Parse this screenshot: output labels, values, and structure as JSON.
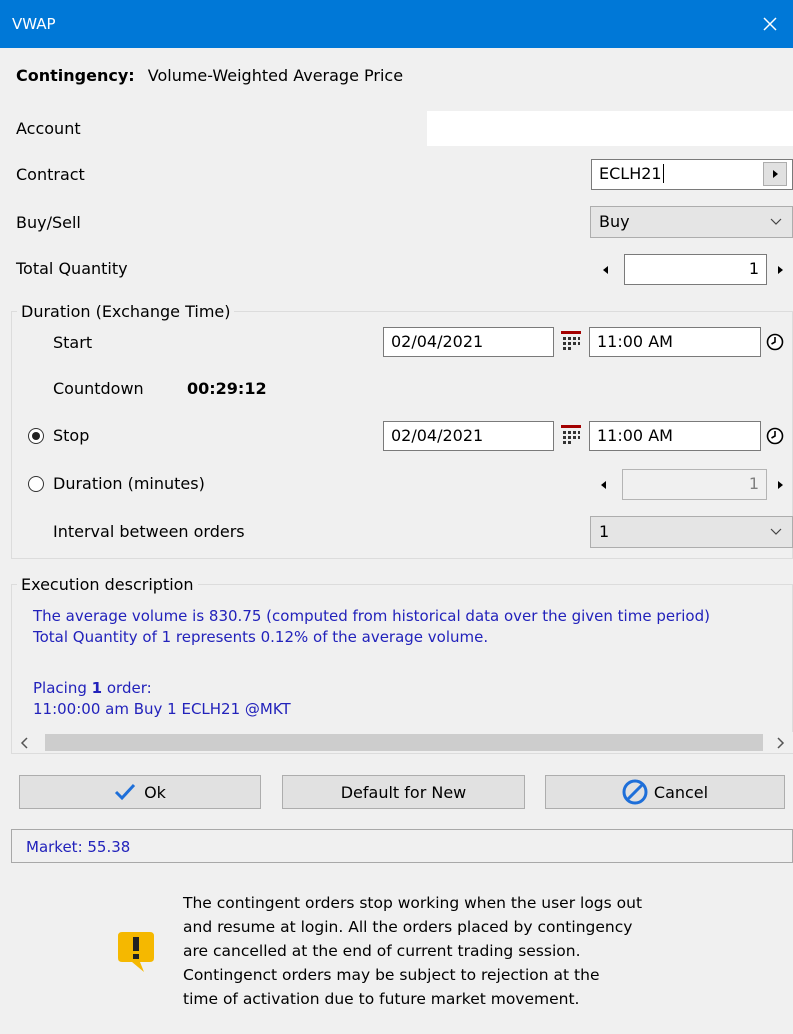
{
  "window": {
    "title": "VWAP"
  },
  "contingency": {
    "label": "Contingency:",
    "value": "Volume-Weighted Average Price"
  },
  "account": {
    "label": "Account",
    "value": ""
  },
  "contract": {
    "label": "Contract",
    "value": "ECLH21"
  },
  "buy_sell": {
    "label": "Buy/Sell",
    "value": "Buy"
  },
  "total_quantity": {
    "label": "Total Quantity",
    "value": "1"
  },
  "duration": {
    "group_title": "Duration (Exchange Time)",
    "start": {
      "label": "Start",
      "date": "02/04/2021",
      "time": "11:00 AM"
    },
    "countdown": {
      "label": "Countdown",
      "value": "00:29:12"
    },
    "stop": {
      "label": "Stop",
      "date": "02/04/2021",
      "time": "11:00 AM",
      "selected": true
    },
    "duration_minutes": {
      "label": "Duration (minutes)",
      "value": "1",
      "selected": false
    },
    "interval": {
      "label": "Interval between orders",
      "value": "1"
    }
  },
  "execution": {
    "group_title": "Execution description",
    "line1": "The average volume is 830.75 (computed from historical data over the given time period)",
    "line2": "Total Quantity of 1 represents 0.12% of the average volume.",
    "placing_prefix": "Placing",
    "placing_count": "1",
    "placing_suffix": "order:",
    "order_line": "11:00:00 am Buy 1 ECLH21 @MKT"
  },
  "buttons": {
    "ok": "Ok",
    "default": "Default for New",
    "cancel": "Cancel"
  },
  "status": {
    "market": "Market: 55.38"
  },
  "notice": {
    "line1": "The contingent orders stop working when the user logs out",
    "line2": "and resume at login. All the orders placed by contingency",
    "line3": "are cancelled at the end of current trading session.",
    "line4": "Contingenct orders may be subject to rejection at the",
    "line5": "time of activation due to future market movement."
  },
  "colors": {
    "titlebar": "#0078d7",
    "info_text": "#2222bb",
    "warning": "#f5b800",
    "ok_check": "#1e6fd9"
  }
}
